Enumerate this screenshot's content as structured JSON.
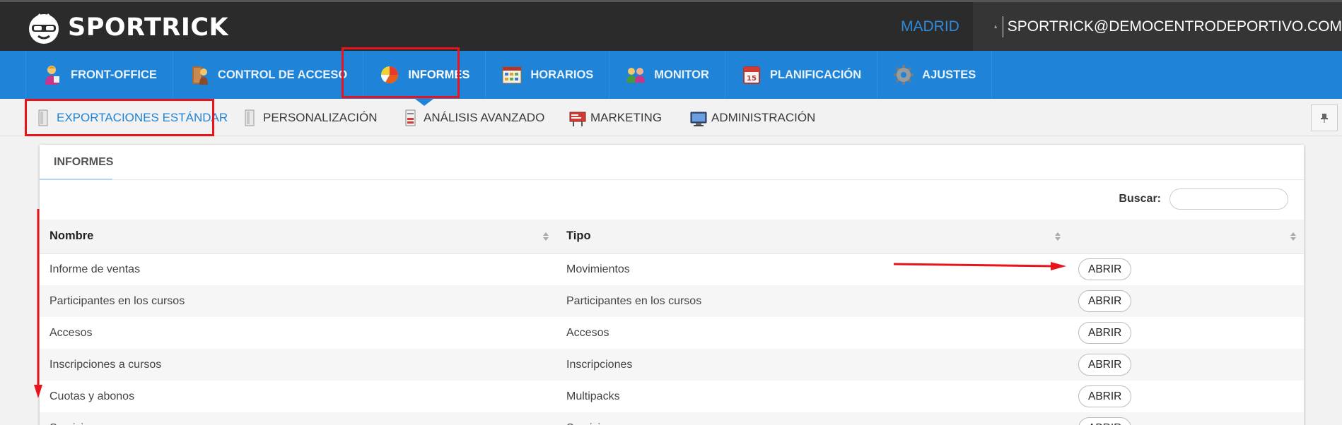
{
  "header": {
    "brand": "SPORTRICK",
    "city": "MADRID",
    "user_email": "SPORTRICK@DEMOCENTRODEPORTIVO.COM"
  },
  "main_nav": {
    "items": [
      {
        "label": "FRONT-OFFICE",
        "icon": "front-office-person-icon"
      },
      {
        "label": "CONTROL DE ACCESO",
        "icon": "access-control-icon"
      },
      {
        "label": "INFORMES",
        "icon": "pie-chart-icon",
        "active": true
      },
      {
        "label": "HORARIOS",
        "icon": "calendar-grid-icon"
      },
      {
        "label": "MONITOR",
        "icon": "monitor-people-icon"
      },
      {
        "label": "PLANIFICACIÓN",
        "icon": "planner-calendar-icon"
      },
      {
        "label": "AJUSTES",
        "icon": "gear-icon"
      }
    ]
  },
  "sub_nav": {
    "items": [
      {
        "label": "EXPORTACIONES ESTÁNDAR",
        "icon": "document-icon",
        "active": true
      },
      {
        "label": "PERSONALIZACIÓN",
        "icon": "document-icon"
      },
      {
        "label": "ANÁLISIS AVANZADO",
        "icon": "report-icon"
      },
      {
        "label": "MARKETING",
        "icon": "marketing-board-icon"
      },
      {
        "label": "ADMINISTRACIÓN",
        "icon": "computer-icon"
      }
    ],
    "pin_icon": "pin-icon"
  },
  "panel": {
    "tab_label": "INFORMES",
    "search_label": "Buscar:",
    "search_value": "",
    "table": {
      "columns": [
        "Nombre",
        "Tipo",
        ""
      ],
      "open_label": "ABRIR",
      "rows": [
        {
          "nombre": "Informe de ventas",
          "tipo": "Movimientos"
        },
        {
          "nombre": "Participantes en los cursos",
          "tipo": "Participantes en los cursos"
        },
        {
          "nombre": "Accesos",
          "tipo": "Accesos"
        },
        {
          "nombre": "Inscripciones a cursos",
          "tipo": "Inscripciones"
        },
        {
          "nombre": "Cuotas y abonos",
          "tipo": "Multipacks"
        },
        {
          "nombre": "Servicios",
          "tipo": "Servicios"
        }
      ]
    }
  },
  "colors": {
    "topbar": "#2b2b2b",
    "nav_blue": "#1f84d8",
    "annotation_red": "#e8141b"
  }
}
